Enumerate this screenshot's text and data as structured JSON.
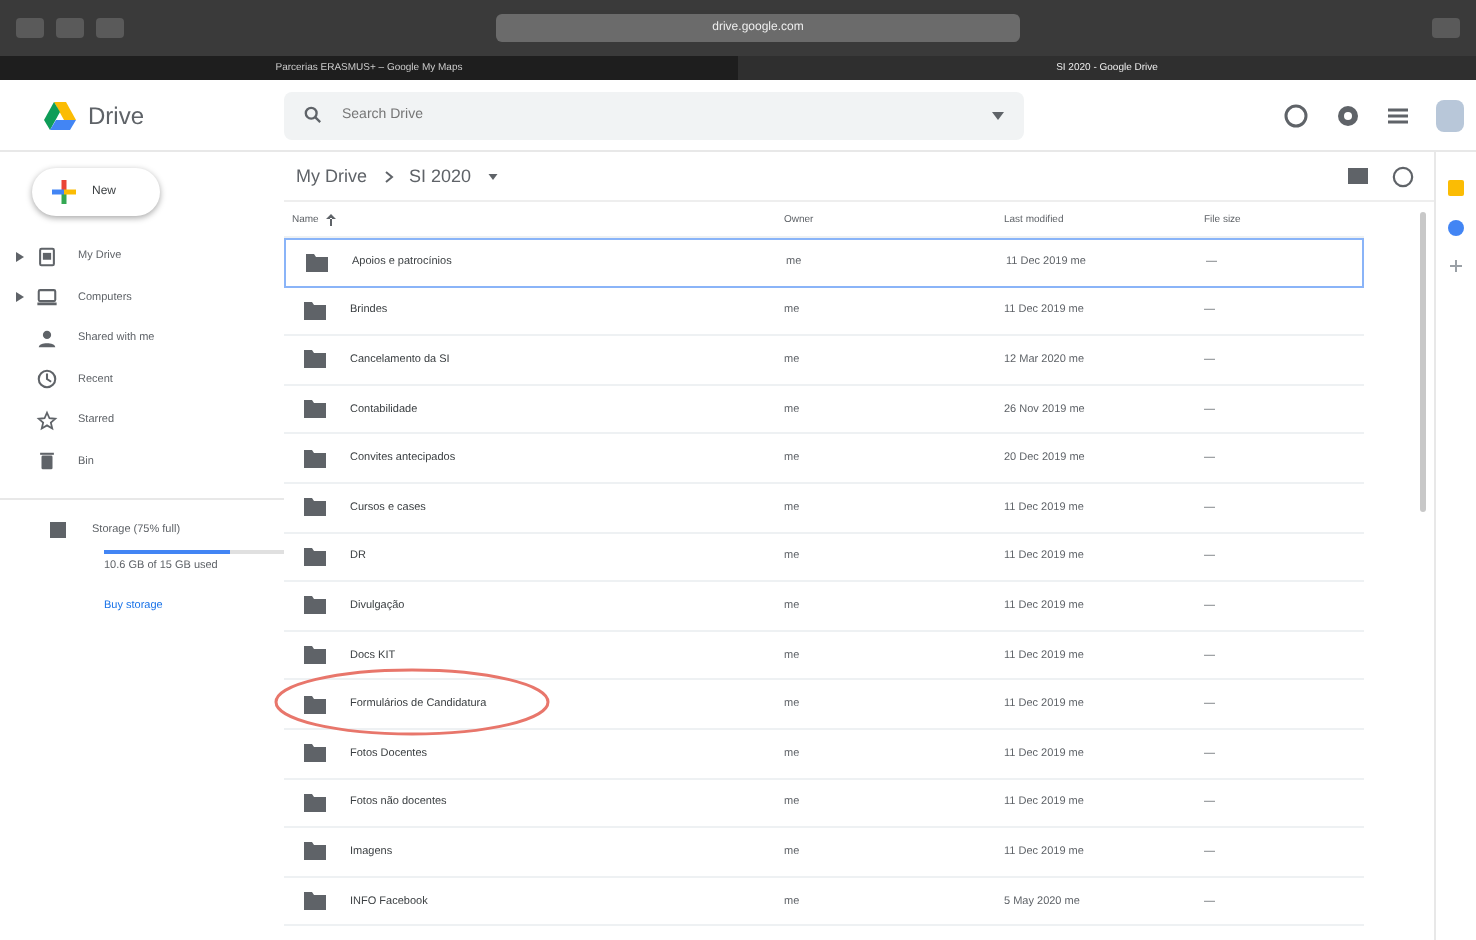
{
  "browser": {
    "url": "drive.google.com",
    "tabs": [
      {
        "title": "Parcerias ERASMUS+ – Google My Maps",
        "selected": false
      },
      {
        "title": "SI 2020 - Google Drive",
        "selected": true
      }
    ]
  },
  "header": {
    "app_name": "Drive",
    "search": {
      "placeholder": "Search Drive"
    }
  },
  "sidebar": {
    "new_button": "New",
    "items": [
      {
        "label": "My Drive",
        "kind": "drive",
        "expandable": true
      },
      {
        "label": "Computers",
        "kind": "computer",
        "expandable": true
      },
      {
        "label": "Shared with me",
        "kind": "shared",
        "expandable": false
      },
      {
        "label": "Recent",
        "kind": "recent",
        "expandable": false
      },
      {
        "label": "Starred",
        "kind": "star",
        "expandable": false
      },
      {
        "label": "Bin",
        "kind": "bin",
        "expandable": false
      }
    ],
    "storage": {
      "label": "Storage (75% full)",
      "level": 0.7,
      "usage": "10.6 GB of 15 GB used",
      "link": "Buy storage"
    }
  },
  "breadcrumb": [
    "My Drive",
    "SI 2020"
  ],
  "table": {
    "columns": [
      "Name",
      "Owner",
      "Last modified",
      "File size"
    ],
    "rows": [
      {
        "name": "Apoios e patrocínios",
        "owner": "me",
        "modified": "11 Dec 2019 me",
        "size": "—",
        "selected": true,
        "circled": false
      },
      {
        "name": "Brindes",
        "owner": "me",
        "modified": "11 Dec 2019 me",
        "size": "—",
        "selected": false,
        "circled": false
      },
      {
        "name": "Cancelamento da SI",
        "owner": "me",
        "modified": "12 Mar 2020 me",
        "size": "—",
        "selected": false,
        "circled": false
      },
      {
        "name": "Contabilidade",
        "owner": "me",
        "modified": "26 Nov 2019 me",
        "size": "—",
        "selected": false,
        "circled": false
      },
      {
        "name": "Convites antecipados",
        "owner": "me",
        "modified": "20 Dec 2019 me",
        "size": "—",
        "selected": false,
        "circled": false
      },
      {
        "name": "Cursos e cases",
        "owner": "me",
        "modified": "11 Dec 2019 me",
        "size": "—",
        "selected": false,
        "circled": false
      },
      {
        "name": "DR",
        "owner": "me",
        "modified": "11 Dec 2019 me",
        "size": "—",
        "selected": false,
        "circled": false
      },
      {
        "name": "Divulgação",
        "owner": "me",
        "modified": "11 Dec 2019 me",
        "size": "—",
        "selected": false,
        "circled": false
      },
      {
        "name": "Docs KIT",
        "owner": "me",
        "modified": "11 Dec 2019 me",
        "size": "—",
        "selected": false,
        "circled": false
      },
      {
        "name": "Formulários de Candidatura",
        "owner": "me",
        "modified": "11 Dec 2019 me",
        "size": "—",
        "selected": false,
        "circled": true
      },
      {
        "name": "Fotos Docentes",
        "owner": "me",
        "modified": "11 Dec 2019 me",
        "size": "—",
        "selected": false,
        "circled": false
      },
      {
        "name": "Fotos não docentes",
        "owner": "me",
        "modified": "11 Dec 2019 me",
        "size": "—",
        "selected": false,
        "circled": false
      },
      {
        "name": "Imagens",
        "owner": "me",
        "modified": "11 Dec 2019 me",
        "size": "—",
        "selected": false,
        "circled": false
      },
      {
        "name": "INFO Facebook",
        "owner": "me",
        "modified": "5 May 2020 me",
        "size": "—",
        "selected": false,
        "circled": false
      }
    ]
  }
}
